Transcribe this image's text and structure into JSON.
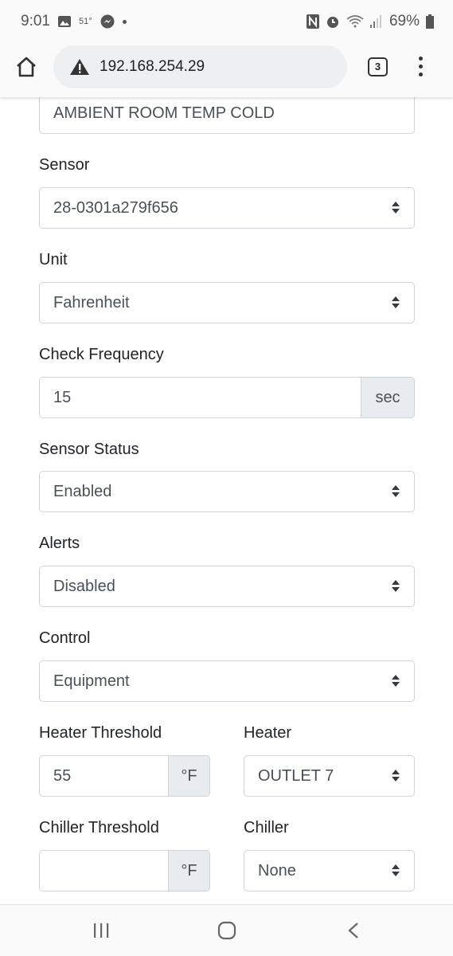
{
  "status_bar": {
    "time": "9:01",
    "temperature": "51°",
    "battery": "69%"
  },
  "browser": {
    "url": "192.168.254.29",
    "tab_count": "3"
  },
  "form": {
    "name_value": "AMBIENT ROOM TEMP COLD",
    "sensor": {
      "label": "Sensor",
      "value": "28-0301a279f656"
    },
    "unit": {
      "label": "Unit",
      "value": "Fahrenheit"
    },
    "check_frequency": {
      "label": "Check Frequency",
      "value": "15",
      "addon": "sec"
    },
    "sensor_status": {
      "label": "Sensor Status",
      "value": "Enabled"
    },
    "alerts": {
      "label": "Alerts",
      "value": "Disabled"
    },
    "control": {
      "label": "Control",
      "value": "Equipment"
    },
    "heater_threshold": {
      "label": "Heater Threshold",
      "value": "55",
      "addon": "°F"
    },
    "heater": {
      "label": "Heater",
      "value": "OUTLET 7"
    },
    "chiller_threshold": {
      "label": "Chiller Threshold",
      "value": "",
      "addon": "°F"
    },
    "chiller": {
      "label": "Chiller",
      "value": "None"
    }
  }
}
